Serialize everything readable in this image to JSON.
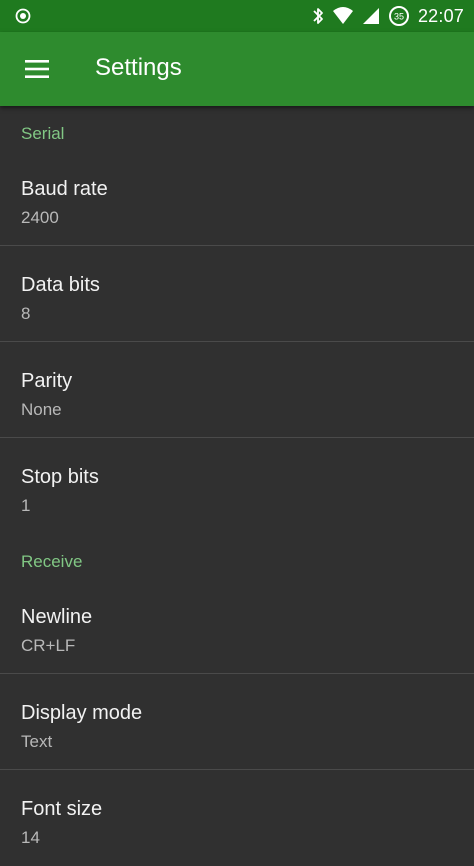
{
  "status_bar": {
    "time": "22:07",
    "battery_level": "35",
    "icons": [
      "sync-icon",
      "bluetooth-icon",
      "wifi-icon",
      "signal-icon",
      "battery-icon"
    ]
  },
  "app_bar": {
    "title": "Settings",
    "menu_icon": "hamburger-menu-icon"
  },
  "colors": {
    "status_bar": "#1f7a1f",
    "app_bar": "#2e8b2e",
    "background": "#303030",
    "accent": "#81c784",
    "divider": "#4a4a4a"
  },
  "sections": [
    {
      "header": "Serial",
      "items": [
        {
          "title": "Baud rate",
          "summary": "2400"
        },
        {
          "title": "Data bits",
          "summary": "8"
        },
        {
          "title": "Parity",
          "summary": "None"
        },
        {
          "title": "Stop bits",
          "summary": "1"
        }
      ]
    },
    {
      "header": "Receive",
      "items": [
        {
          "title": "Newline",
          "summary": "CR+LF"
        },
        {
          "title": "Display mode",
          "summary": "Text"
        },
        {
          "title": "Font size",
          "summary": "14"
        }
      ]
    }
  ]
}
